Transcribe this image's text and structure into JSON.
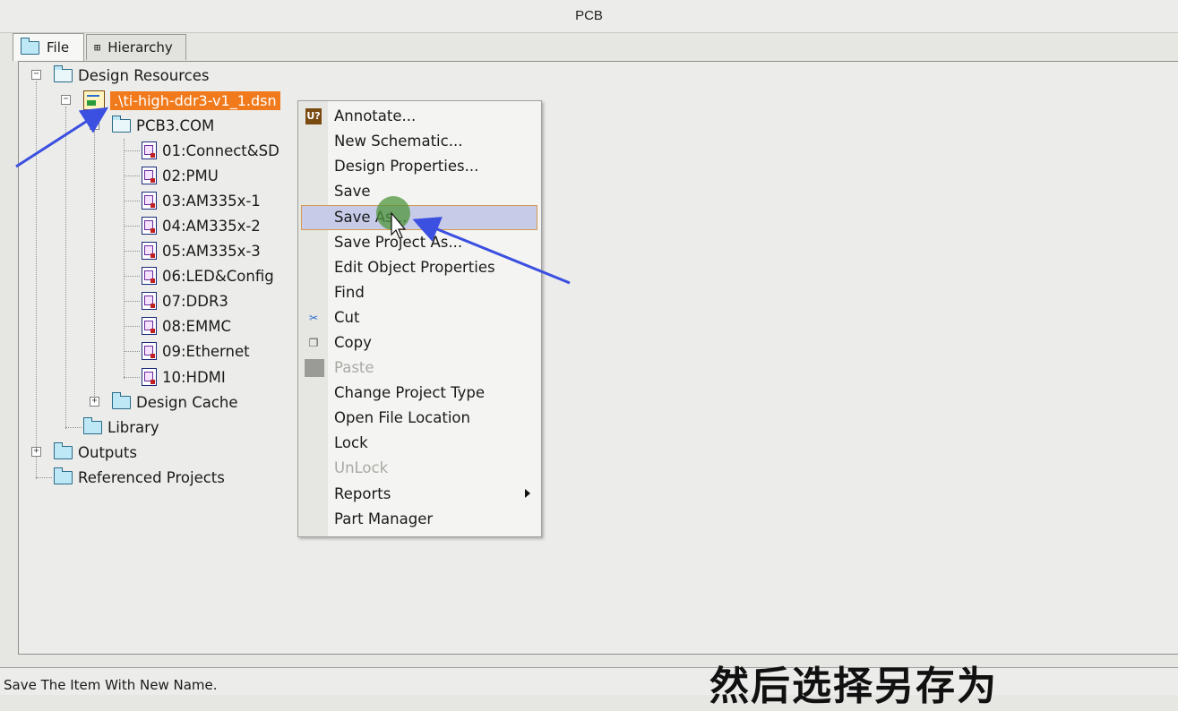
{
  "window": {
    "title": "PCB"
  },
  "tabs": [
    {
      "label": "File",
      "icon": "folder-icon"
    },
    {
      "label": "Hierarchy",
      "icon": "hierarchy-icon"
    }
  ],
  "tree": {
    "design_resources": "Design Resources",
    "dsn_file": ".\\ti-high-ddr3-v1_1.dsn",
    "pcb_folder": "PCB3.COM",
    "pages": [
      "01:Connect&SD",
      "02:PMU",
      "03:AM335x-1",
      "04:AM335x-2",
      "05:AM335x-3",
      "06:LED&Config",
      "07:DDR3",
      "08:EMMC",
      "09:Ethernet",
      "10:HDMI"
    ],
    "design_cache": "Design Cache",
    "library": "Library",
    "outputs": "Outputs",
    "referenced_projects": "Referenced Projects"
  },
  "context_menu": {
    "items": [
      {
        "label": "Annotate...",
        "icon": "annotate-icon"
      },
      {
        "label": "New Schematic..."
      },
      {
        "label": "Design Properties..."
      },
      {
        "label": "Save"
      },
      {
        "label": "Save As...",
        "highlighted": true
      },
      {
        "label": "Save Project As..."
      },
      {
        "label": "Edit Object Properties"
      },
      {
        "label": "Find"
      },
      {
        "label": "Cut",
        "icon": "scissors-icon"
      },
      {
        "label": "Copy",
        "icon": "copy-icon"
      },
      {
        "label": "Paste",
        "disabled": true,
        "icon": "paste-icon"
      },
      {
        "label": "Change Project Type"
      },
      {
        "label": "Open File Location"
      },
      {
        "label": "Lock"
      },
      {
        "label": "UnLock",
        "disabled": true
      },
      {
        "label": "Reports",
        "submenu": true
      },
      {
        "label": "Part Manager"
      }
    ]
  },
  "status": {
    "text": "Save The Item With New Name."
  },
  "caption": "然后选择另存为",
  "colors": {
    "selection": "#f07a1c",
    "menu_highlight": "#c7cbe8",
    "annotation_arrow": "#3b4fe0"
  }
}
